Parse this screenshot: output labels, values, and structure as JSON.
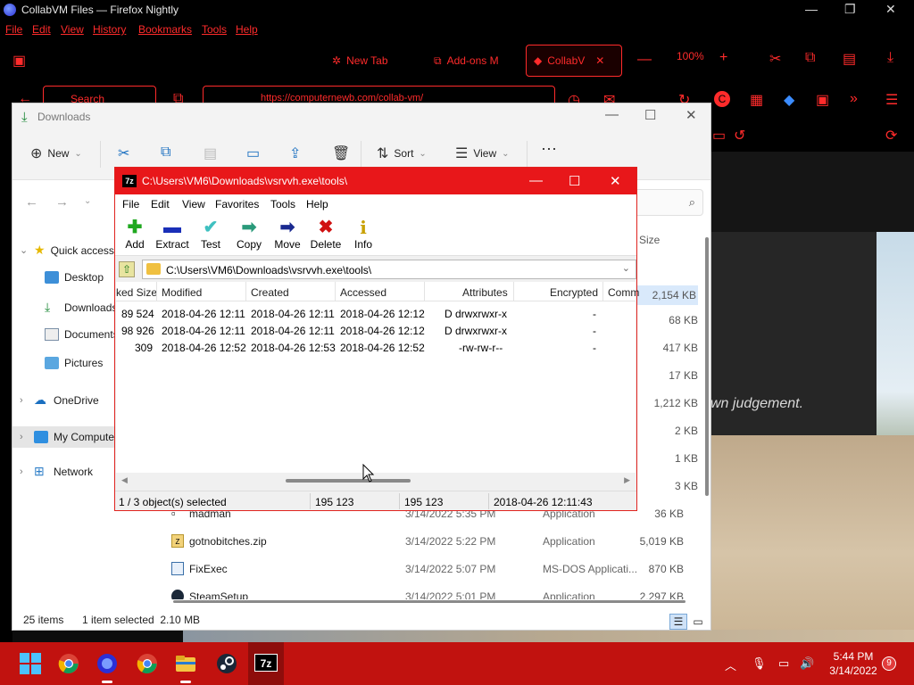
{
  "browser": {
    "title": "CollabVM Files — Firefox Nightly",
    "menu": [
      "File",
      "Edit",
      "View",
      "History",
      "Bookmarks",
      "Tools",
      "Help"
    ],
    "tabs": [
      {
        "label": "New Tab",
        "icon": "extension-icon"
      },
      {
        "label": "Add-ons M",
        "icon": "puzzle-icon"
      },
      {
        "label": "CollabV",
        "icon": "vm-icon",
        "active": true
      }
    ],
    "zoom": "100%",
    "search_placeholder": "Search",
    "url_text": "https://computernewb.com/collab-vm/",
    "page_text": "wn judgement.",
    "accent_color": "#ff2b2b"
  },
  "explorer": {
    "title": "Downloads",
    "toolbar": {
      "new": "New",
      "sort": "Sort",
      "view": "View"
    },
    "nav": {
      "quick_access": "Quick access",
      "desktop": "Desktop",
      "downloads": "Downloads",
      "documents": "Documents",
      "pictures": "Pictures",
      "onedrive": "OneDrive",
      "this_pc": "My Computer",
      "network": "Network"
    },
    "size_header": "Size",
    "sizes_top": [
      "2,154 KB",
      "68 KB",
      "417 KB",
      "17 KB",
      "1,212 KB",
      "2 KB",
      "1 KB",
      "3 KB"
    ],
    "files": [
      {
        "name": "madman",
        "date": "3/14/2022 5:35 PM",
        "type": "Application",
        "size": "36 KB"
      },
      {
        "name": "gotnobitches.zip",
        "date": "3/14/2022 5:22 PM",
        "type": "Application",
        "size": "5,019 KB"
      },
      {
        "name": "FixExec",
        "date": "3/14/2022 5:07 PM",
        "type": "MS-DOS Applicati...",
        "size": "870 KB"
      },
      {
        "name": "SteamSetup",
        "date": "3/14/2022 5:01 PM",
        "type": "Application",
        "size": "2,297 KB"
      }
    ],
    "status": {
      "items": "25 items",
      "selected": "1 item selected  2.10 MB"
    }
  },
  "sevenzip": {
    "title": "C:\\Users\\VM6\\Downloads\\vsrvvh.exe\\tools\\",
    "menu": [
      "File",
      "Edit",
      "View",
      "Favorites",
      "Tools",
      "Help"
    ],
    "tools": [
      {
        "label": "Add",
        "icon": "plus-icon",
        "color": "#1fa81f"
      },
      {
        "label": "Extract",
        "icon": "minus-icon",
        "color": "#1a2fb8"
      },
      {
        "label": "Test",
        "icon": "check-icon",
        "color": "#3fc0c0"
      },
      {
        "label": "Copy",
        "icon": "arrow-right-icon",
        "color": "#2a9a7a"
      },
      {
        "label": "Move",
        "icon": "arrow-right-icon",
        "color": "#1a2a90"
      },
      {
        "label": "Delete",
        "icon": "x-icon",
        "color": "#d01010"
      },
      {
        "label": "Info",
        "icon": "info-icon",
        "color": "#c8a000"
      }
    ],
    "path": "C:\\Users\\VM6\\Downloads\\vsrvvh.exe\\tools\\",
    "columns": [
      "ked Size",
      "Modified",
      "Created",
      "Accessed",
      "Attributes",
      "Encrypted",
      "Comm"
    ],
    "rows": [
      {
        "packed": "89 524",
        "modified": "2018-04-26 12:11",
        "created": "2018-04-26 12:11",
        "accessed": "2018-04-26 12:12",
        "attributes": "D drwxrwxr-x",
        "encrypted": "-"
      },
      {
        "packed": "98 926",
        "modified": "2018-04-26 12:11",
        "created": "2018-04-26 12:11",
        "accessed": "2018-04-26 12:12",
        "attributes": "D drwxrwxr-x",
        "encrypted": "-"
      },
      {
        "packed": "309",
        "modified": "2018-04-26 12:52",
        "created": "2018-04-26 12:53",
        "accessed": "2018-04-26 12:52",
        "attributes": "-rw-rw-r--",
        "encrypted": "-"
      }
    ],
    "status": {
      "selection": "1 / 3 object(s) selected",
      "size": "195 123",
      "packed": "195 123",
      "date": "2018-04-26 12:11:43"
    },
    "title_color": "#e8171a"
  },
  "taskbar": {
    "icons": [
      "start-icon",
      "chrome-icon",
      "firefox-nightly-icon",
      "chrome-icon",
      "file-explorer-icon",
      "steam-icon",
      "7zip-icon"
    ],
    "time": "5:44 PM",
    "date": "3/14/2022",
    "notifications": "9",
    "color": "#c1120f"
  }
}
